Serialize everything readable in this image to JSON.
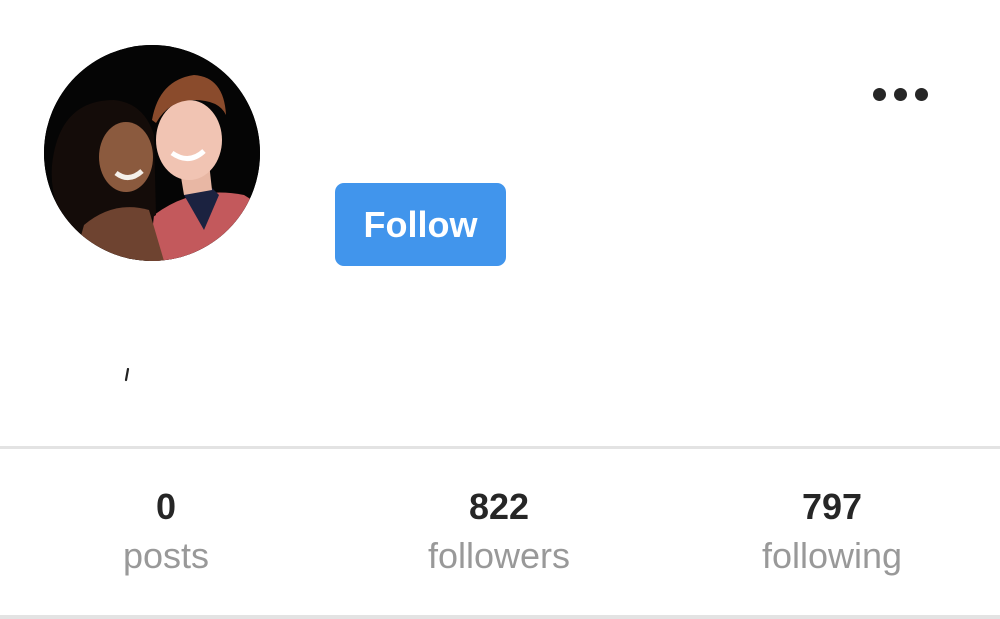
{
  "profile": {
    "avatar_alt": "profile-photo",
    "follow_label": "Follow",
    "menu_icon": "more-options-icon"
  },
  "stats": [
    {
      "count": "0",
      "label": "posts"
    },
    {
      "count": "822",
      "label": "followers"
    },
    {
      "count": "797",
      "label": "following"
    }
  ],
  "colors": {
    "follow_button": "#4195ec",
    "count_text": "#262626",
    "label_text": "#999999",
    "divider": "#e3e3e3"
  }
}
